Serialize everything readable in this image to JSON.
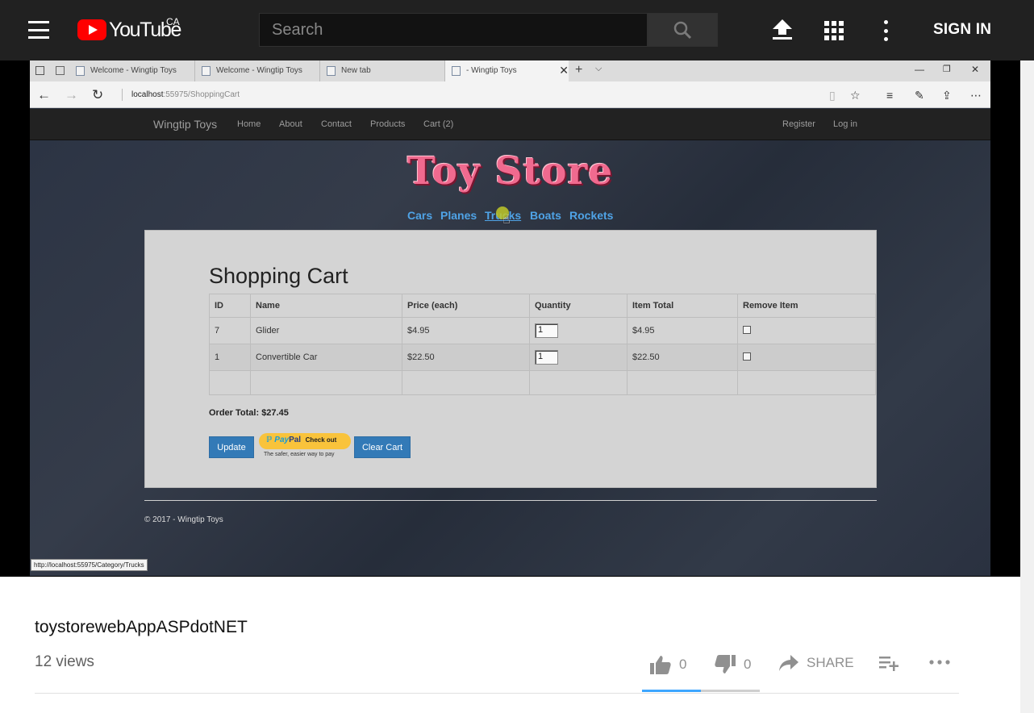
{
  "masthead": {
    "logo_text": "YouTube",
    "country": "CA",
    "search_placeholder": "Search",
    "signin_label": "SIGN IN"
  },
  "browser": {
    "tabs": [
      {
        "label": "Welcome - Wingtip Toys"
      },
      {
        "label": "Welcome - Wingtip Toys"
      },
      {
        "label": "New tab"
      },
      {
        "label": "- Wingtip Toys"
      }
    ],
    "address_host": "localhost",
    "address_path": ":55975/ShoppingCart",
    "status_url": "http://localhost:55975/Category/Trucks"
  },
  "site": {
    "brand": "Wingtip Toys",
    "nav_links": [
      "Home",
      "About",
      "Contact",
      "Products",
      "Cart (2)"
    ],
    "auth_links": [
      "Register",
      "Log in"
    ],
    "store_title": "Toy Store",
    "categories": [
      "Cars",
      "Planes",
      "Trucks",
      "Boats",
      "Rockets"
    ],
    "cart": {
      "title": "Shopping Cart",
      "headers": [
        "ID",
        "Name",
        "Price (each)",
        "Quantity",
        "Item Total",
        "Remove Item"
      ],
      "rows": [
        {
          "id": "7",
          "name": "Glider",
          "price": "$4.95",
          "qty": "1",
          "total": "$4.95"
        },
        {
          "id": "1",
          "name": "Convertible Car",
          "price": "$22.50",
          "qty": "1",
          "total": "$22.50"
        }
      ],
      "order_total": "Order Total: $27.45",
      "update_label": "Update",
      "paypal_brand_1": "Pay",
      "paypal_brand_2": "Pal",
      "paypal_checkout": "Check out",
      "paypal_sub": "The safer, easier way to pay",
      "clear_label": "Clear Cart"
    },
    "footer": "© 2017 - Wingtip Toys"
  },
  "video": {
    "title": "toystorewebAppASPdotNET",
    "views": "12 views",
    "likes": "0",
    "dislikes": "0",
    "share_label": "SHARE"
  },
  "colors": {
    "accent_blue": "#3ea6ff",
    "brand_red": "#ff0000",
    "bootstrap_btn": "#337ab7",
    "category_link": "#4fa3e6"
  }
}
